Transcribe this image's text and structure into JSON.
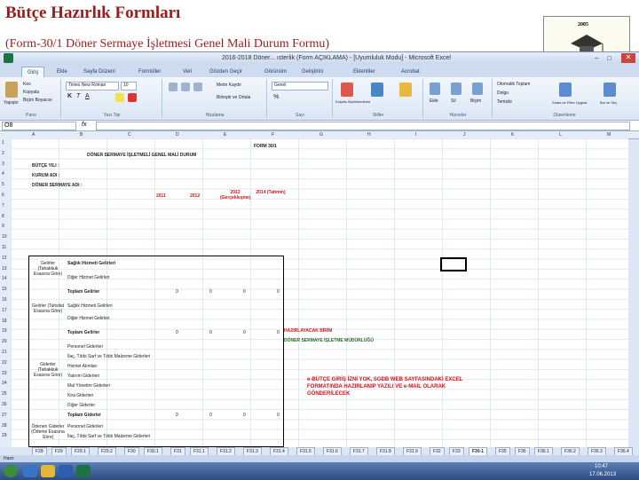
{
  "slide": {
    "title": "Bütçe Hazırlık Formları",
    "subtitle": "(Form-30/1 Döner Sermaye İşletmesi Genel Mali Durum Formu)",
    "logo_text": "2005"
  },
  "excel": {
    "window_title": "2016-2018 Döner... ısterlik (Form AÇIKLAMA) - [Uyumluluk Modu] - Microsoft Excel",
    "ribbon_tabs": [
      "Giriş",
      "Ekle",
      "Sayfa Düzeni",
      "Formüller",
      "Veri",
      "Gözden Geçir",
      "Görünüm",
      "Geliştirici",
      "Eklentiler",
      "Acrobat"
    ],
    "active_tab_index": 0,
    "ribbon_groups": [
      "Pano",
      "Yazı Tipi",
      "Hizalama",
      "Sayı",
      "Stiller",
      "Hücreler",
      "Düzenleme"
    ],
    "ribbon_buttons": {
      "paste": "Yapıştır",
      "cut": "Kes",
      "copy": "Kopyala",
      "format_painter": "Biçim Boyacısı",
      "font_name": "Times New Roman",
      "font_size": "10",
      "wrap_text": "Metni Kaydır",
      "merge_center": "Birleştir ve Ortala",
      "number_format": "Genel",
      "conditional_format": "Koşullu Biçimlendirme",
      "format_as_table": "Tablo Olarak Biçimlendir",
      "cell_styles": "Hücre Stilleri",
      "insert": "Ekle",
      "delete": "Sil",
      "format": "Biçim",
      "autosum": "Otomatik Toplam",
      "fill": "Dolgu",
      "clear": "Temizle",
      "sort_filter": "Sırala ve Filtre Uygula",
      "find_select": "Bul ve Seç"
    },
    "name_box": "O8",
    "formula_fx": "fx",
    "columns": [
      "A",
      "B",
      "C",
      "D",
      "E",
      "F",
      "G",
      "H",
      "I",
      "J",
      "K",
      "L",
      "M"
    ],
    "rows": [
      "1",
      "2",
      "3",
      "4",
      "5",
      "6",
      "7",
      "8",
      "9",
      "10",
      "11",
      "12",
      "13",
      "14",
      "15",
      "16",
      "17",
      "18",
      "19",
      "20",
      "21",
      "22",
      "23",
      "24",
      "25",
      "26",
      "27",
      "28",
      "29"
    ],
    "cells": {
      "form_no": "FORM 30/1",
      "header": "DÖNER SERMAYE İŞLETMELİ GENEL MALİ DURUM",
      "butce_yili": "BÜTÇE YILI :",
      "kurum_adi": "KURUM ADI :",
      "dsi_adi": "DÖNER SERMAYE ADI :",
      "year1": "2011",
      "year2": "2012",
      "year3": "2013 (Gerçekleşme)",
      "year4": "2014 (Tahmin)",
      "gelirler_title": "Gelirler (Tahakkuk Esasına Göre)",
      "g1": "Sağlık Hizmeti Gelirleri",
      "g2": "Diğer Hizmet Gelirleri",
      "g3": "Toplam Gelirler",
      "tahsil_title": "Gelirler (Tahsilat Esasına Göre)",
      "t1": "Sağlık Hizmeti Gelirleri",
      "t2": "Diğer Hizmet Gelirleri",
      "t3": "Toplam Gelirler",
      "gider_title": "Giderler (Tahakkuk Esasına Göre)",
      "d1": "Personel Giderleri",
      "d2": "İlaç, Tıbbi Sarf ve Tıbbi Malzeme Giderleri",
      "d3": "Hizmet Alımları",
      "d4": "Yatırım Giderleri",
      "d5": "Mal Yönetim Giderleri",
      "d6": "Kira Giderleri",
      "d7": "Diğer Giderler",
      "d8": "Toplam Giderler",
      "odenen_title": "Ödenen Giderler (Ödeme Esasına Göre)",
      "o1": "Personel Giderleri",
      "o2": "İlaç, Tıbbi Sarf ve Tıbbi Malzeme Giderleri",
      "o3": "Hizmet Alımları",
      "o4": "Yatırım Giderleri",
      "o5": "Mal Yönetim Giderleri",
      "o6": "Kira Giderleri",
      "o7": "Diğer Giderler",
      "zero": "0",
      "hazirlayacak_title": "HAZIRLAYACAK BİRİM",
      "hazirlayacak_unit": "DÖNER SERMAYE İŞLETME MÜDÜRLÜĞÜ",
      "note": "e-BÜTÇE GİRİŞ İZNİ YOK, SGDB WEB SAYFASINDAKİ EXCEL FORMATINDA HAZIRLANIP YAZILI VE e-MAİL OLARAK GÖNDERİLECEK"
    },
    "sheet_tabs": [
      "F28",
      "F29",
      "F29.1",
      "F29.2",
      "F30",
      "F30.1",
      "F31",
      "F31.1",
      "F31.2",
      "F31.3",
      "F31.4",
      "F31.5",
      "F31.6",
      "F31.7",
      "F31.8",
      "F31.9",
      "F32",
      "F33",
      "F30-1",
      "F35",
      "F36",
      "F36.1",
      "F36.2",
      "F36.3",
      "F36.4",
      "F36.5"
    ],
    "active_sheet": "F30-1",
    "status_text": "Hazır",
    "clock_time": "10:47",
    "clock_date": "17.06.2013"
  }
}
